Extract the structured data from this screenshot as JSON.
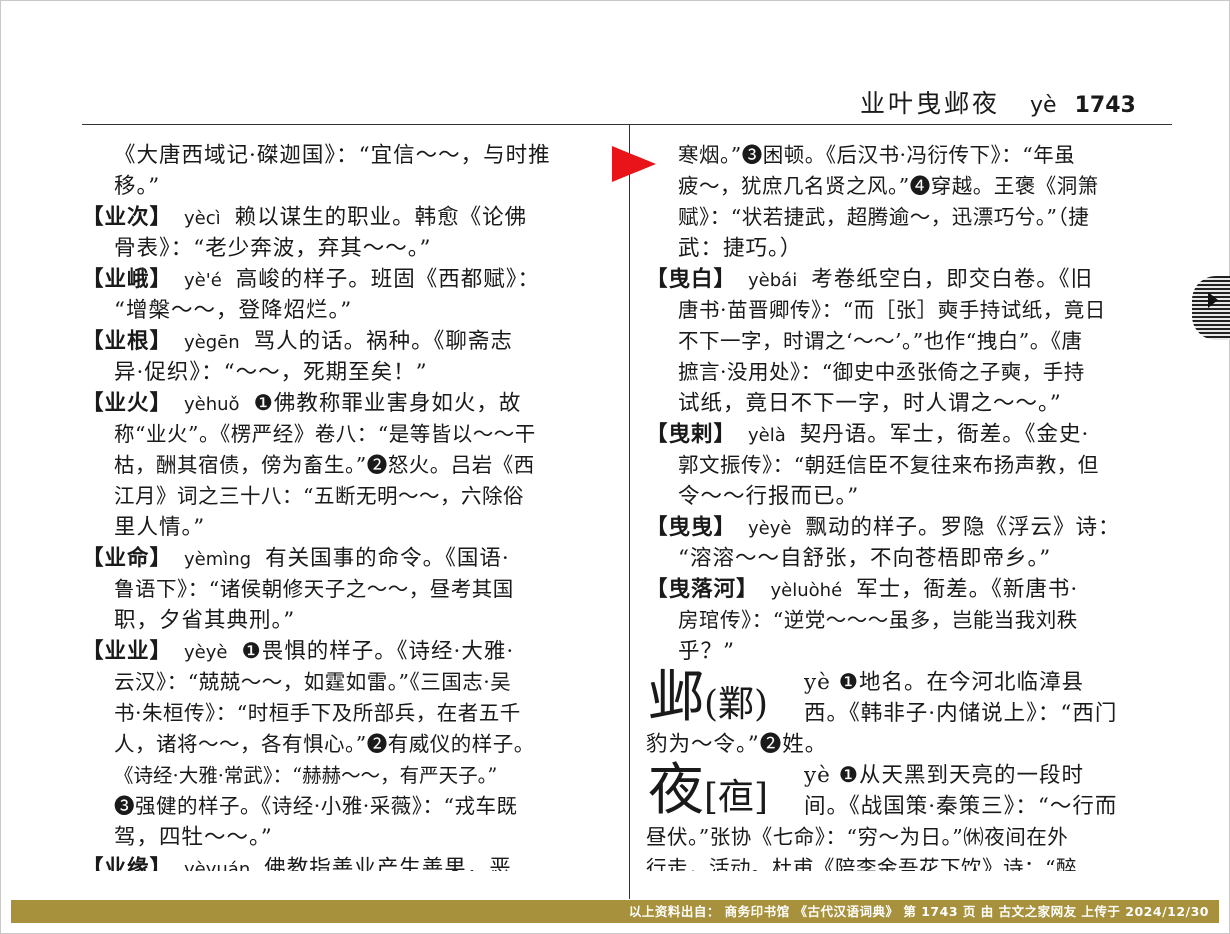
{
  "header": {
    "words": "业叶曳邺夜",
    "pinyin": "yè",
    "page_number": "1743"
  },
  "left_column": {
    "lines": [
      {
        "text": "《大唐西域记·磔迦国》：“宜信～～，与时推",
        "indent": true
      },
      {
        "text": "移。”",
        "indent": true
      },
      {
        "hw": "【业次】",
        "py": "yècì",
        "text": "赖以谋生的职业。韩愈《论佛"
      },
      {
        "text": "骨表》：“老少奔波，弃其～～。”",
        "indent": true
      },
      {
        "hw": "【业峨】",
        "py": "yè'é",
        "text": "高峻的样子。班固《西都赋》："
      },
      {
        "text": "“增槃～～，登降炤烂。”",
        "indent": true
      },
      {
        "hw": "【业根】",
        "py": "yègēn",
        "text": "骂人的话。祸种。《聊斋志"
      },
      {
        "text": "异·促织》：“～～，死期至矣！”",
        "indent": true
      },
      {
        "hw": "【业火】",
        "py": "yèhuǒ",
        "text": "❶佛教称罪业害身如火，故"
      },
      {
        "text": "称“业火”。《楞严经》卷八：“是等皆以～～干",
        "indent": true,
        "small": true
      },
      {
        "text": "枯，酬其宿债，傍为畜生。”❷怒火。吕岩《西",
        "indent": true,
        "small": true
      },
      {
        "text": "江月》词之三十八：“五断无明～～，六除俗",
        "indent": true,
        "small": true
      },
      {
        "text": "里人情。”",
        "indent": true
      },
      {
        "hw": "【业命】",
        "py": "yèmìng",
        "text": "有关国事的命令。《国语·"
      },
      {
        "text": "鲁语下》：“诸侯朝修天子之～～，昼考其国",
        "indent": true,
        "small": true
      },
      {
        "text": "职，夕省其典刑。”",
        "indent": true
      },
      {
        "hw": "【业业】",
        "py": "yèyè",
        "text": "❶畏惧的样子。《诗经·大雅·"
      },
      {
        "text": "云汉》：“兢兢～～，如霆如雷。”《三国志·吴",
        "indent": true,
        "small": true
      },
      {
        "text": "书·朱桓传》：“时桓手下及所部兵，在者五千",
        "indent": true,
        "small": true
      },
      {
        "text": "人，诸将～～，各有惧心。”❷有威仪的样子。",
        "indent": true,
        "small": true
      },
      {
        "text": "《诗经·大雅·常武》：“赫赫～～，有严天子。”",
        "indent": true,
        "tight": true
      },
      {
        "text": "❸强健的样子。《诗经·小雅·采薇》：“戎车既",
        "indent": true,
        "small": true
      },
      {
        "text": "驾，四牡～～。”",
        "indent": true
      },
      {
        "hw": "【业缘】",
        "py": "yèyuán",
        "text": "佛教指善业产生善果，恶",
        "cut": true
      }
    ]
  },
  "right_column": {
    "lines_top": [
      {
        "text": "寒烟。”❸困顿。《后汉书·冯衍传下》：“年虽",
        "indent": true,
        "small": true
      },
      {
        "text": "疲～，犹庶几名贤之风。”❹穿越。王褒《洞箫",
        "indent": true,
        "small": true
      },
      {
        "text": "赋》：“状若捷武，超腾逾～，迅漂巧兮。”（捷",
        "indent": true,
        "small": true
      },
      {
        "text": "武：捷巧。）",
        "indent": true
      },
      {
        "hw": "【曳白】",
        "py": "yèbái",
        "text": "考卷纸空白，即交白卷。《旧"
      },
      {
        "text": "唐书·苗晋卿传》：“而［张］奭手持试纸，竟日",
        "indent": true,
        "small": true
      },
      {
        "text": "不下一字，时谓之‘～～’。”也作“拽白”。《唐",
        "indent": true,
        "small": true
      },
      {
        "text": "摭言·没用处》：“御史中丞张倚之子奭，手持",
        "indent": true,
        "small": true
      },
      {
        "text": "试纸，竟日不下一字，时人谓之～～。”",
        "indent": true
      },
      {
        "hw": "【曳剌】",
        "py": "yèlà",
        "text": "契丹语。军士，衙差。《金史·"
      },
      {
        "text": "郭文振传》：“朝廷信臣不复往来布扬声教，但",
        "indent": true,
        "small": true
      },
      {
        "text": "令～～行报而已。”",
        "indent": true
      },
      {
        "hw": "【曳曳】",
        "py": "yèyè",
        "text": "飘动的样子。罗隐《浮云》诗："
      },
      {
        "text": "“溶溶～～自舒张，不向苍梧即帝乡。”",
        "indent": true
      },
      {
        "hw": "【曳落河】",
        "py": "yèluòhé",
        "text": "军士，衙差。《新唐书·"
      },
      {
        "text": "房琯传》：“逆党～～～虽多，岂能当我刘秩",
        "indent": true,
        "small": true
      },
      {
        "text": "乎？”",
        "indent": true
      }
    ],
    "ye_city": {
      "char": "邺",
      "variant": "(鄴)",
      "line1": "yè  ❶地名。在今河北临漳县",
      "line2": "西。《韩非子·内储说上》：“西门",
      "line3": "豹为～令。”❷姓。"
    },
    "ye_night": {
      "char": "夜",
      "variant": "[亱]",
      "line1": "yè  ❶从天黑到天亮的一段时",
      "line2": "间。《战国策·秦策三》：“～行而",
      "line3": "昼伏。”张协《七命》：“穷～为日。”㉁夜间在外",
      "line4": "行走，活动。杜甫《陪李金吾花下饮》诗：“醉"
    }
  },
  "footer": {
    "text": "以上资料出自：  商务印书馆  《古代汉语词典》  第 1743 页 由 古文之家网友 上传于 2024/12/30"
  },
  "colors": {
    "arrow": "#e8141a",
    "footer_bg": "#a8913c"
  }
}
